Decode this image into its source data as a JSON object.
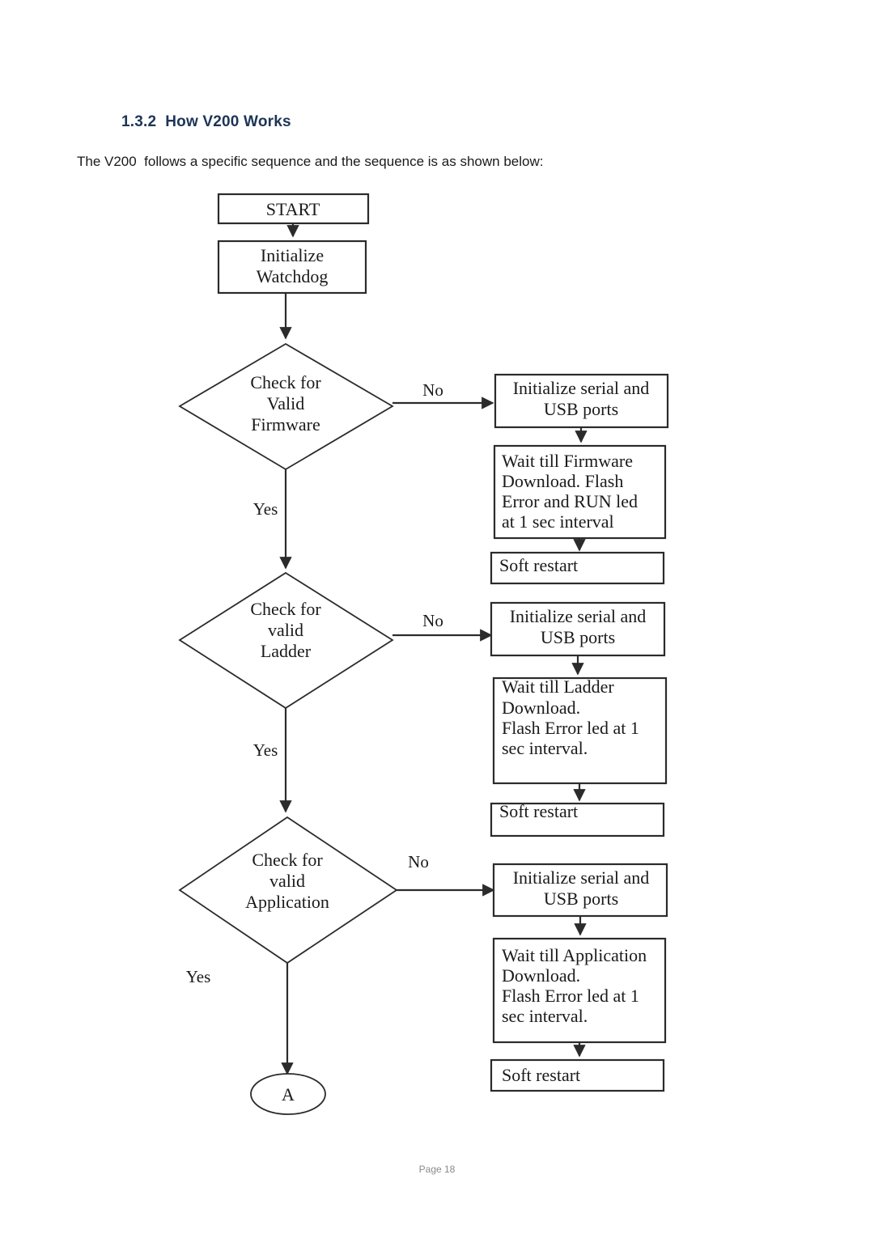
{
  "document": {
    "heading": "1.3.2  How V200 Works",
    "intro": "The V200  follows a specific sequence and the sequence is as shown below:",
    "footer": "Page 18",
    "heading_color": "#1d3557"
  },
  "flowchart": {
    "title": "V200 startup sequence",
    "nodes": {
      "start": "START",
      "init_watchdog": "Initialize\nWatchdog",
      "start_line1": "START",
      "watchdog_line1": "Initialize",
      "watchdog_line2": "Watchdog",
      "decision1_line1": "Check for",
      "decision1_line2": "Valid",
      "decision1_line3": "Firmware",
      "decision2_line1": "Check for",
      "decision2_line2": "valid",
      "decision2_line3": "Ladder",
      "decision3_line1": "Check for",
      "decision3_line2": "valid",
      "decision3_line3": "Application",
      "init_ports1_line1": "Initialize serial and",
      "init_ports1_line2": "USB ports",
      "init_ports2_line1": "Initialize serial and",
      "init_ports2_line2": "USB ports",
      "init_ports3_line1": "Initialize serial and",
      "init_ports3_line2": "USB ports",
      "wait_fw_line1": "Wait till Firmware",
      "wait_fw_line2": "Download. Flash",
      "wait_fw_line3": "Error and RUN led",
      "wait_fw_line4": "at 1 sec interval",
      "wait_ladder_line1": "Wait till Ladder",
      "wait_ladder_line2": "Download.",
      "wait_ladder_line3": "Flash Error led at 1",
      "wait_ladder_line4": "sec interval.",
      "wait_app_line1": "Wait till Application",
      "wait_app_line2": "Download.",
      "wait_app_line3": "Flash Error led at 1",
      "wait_app_line4": "sec interval.",
      "soft_restart1": "Soft restart",
      "soft_restart2": "Soft restart",
      "soft_restart3": "Soft restart",
      "connector_a": "A"
    },
    "edge_labels": {
      "no1": "No",
      "no2": "No",
      "no3": "No",
      "yes1": "Yes",
      "yes2": "Yes",
      "yes3": "Yes"
    }
  }
}
